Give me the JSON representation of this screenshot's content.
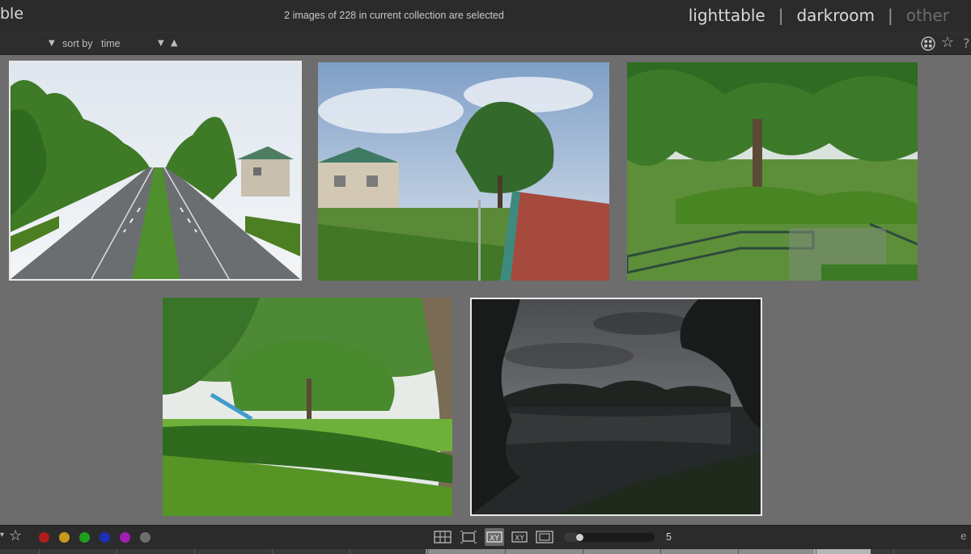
{
  "header": {
    "app_title": "ble",
    "collection_status": "2 images of 228 in current collection are selected",
    "views": [
      {
        "label": "lighttable",
        "active": true
      },
      {
        "label": "darkroom",
        "active": false
      },
      {
        "label": "other",
        "active": false
      }
    ],
    "separator": "|"
  },
  "toolbar_top": {
    "sort_label": "sort by",
    "sort_value": "time",
    "sort_direction_glyph": "▲",
    "dropdown_glyph": "▼",
    "icons": [
      "dropdown-arrow-icon",
      "styles-icon",
      "star-icon",
      "help-icon"
    ],
    "help_glyph": "?"
  },
  "lighttable": {
    "background": "#6d6d6d",
    "thumbnails": [
      {
        "name": "tree-lined-road",
        "selected": true
      },
      {
        "name": "footbridge-houses",
        "selected": false
      },
      {
        "name": "park-trees-railing",
        "selected": false
      },
      {
        "name": "park-lawn-slide",
        "selected": false
      },
      {
        "name": "pond-cloudy-sky",
        "selected": true
      }
    ]
  },
  "toolbar_bottom": {
    "star_glyph": "☆",
    "caret_glyph": "▾",
    "color_labels": [
      {
        "name": "red",
        "color": "#b01c1c"
      },
      {
        "name": "yellow",
        "color": "#c99a1a"
      },
      {
        "name": "green",
        "color": "#1fa01f"
      },
      {
        "name": "blue",
        "color": "#1c2fb8"
      },
      {
        "name": "purple",
        "color": "#a11fb0"
      },
      {
        "name": "gray",
        "color": "#6e6e6e"
      }
    ],
    "layouts": [
      {
        "name": "filemanager",
        "active": false
      },
      {
        "name": "zoomable",
        "active": false
      },
      {
        "name": "culling-fixed",
        "active": true
      },
      {
        "name": "culling-dynamic",
        "active": false
      },
      {
        "name": "preview",
        "active": false
      }
    ],
    "zoom_fraction": 0.17,
    "zoom_value": "5",
    "right_edge_glyph": "e"
  },
  "colors": {
    "accent": "#e9e9e9",
    "panel": "#2b2b2b"
  }
}
